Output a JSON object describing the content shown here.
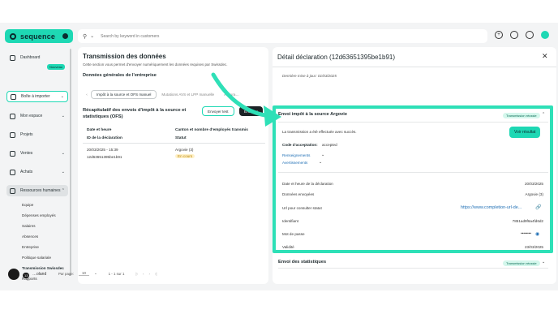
{
  "brand": {
    "name": "sequence"
  },
  "search": {
    "placeholder": "Search by keyword in customers"
  },
  "sidebar": {
    "items": [
      {
        "label": "Dashboard"
      },
      {
        "label": "Boîte à importer",
        "badge": "Nouveau"
      },
      {
        "label": "Mon espace"
      },
      {
        "label": "Projets"
      },
      {
        "label": "Ventes"
      },
      {
        "label": "Achats"
      },
      {
        "label": "Ressources humaines"
      }
    ],
    "subitems": [
      "Equipe",
      "Dépenses employés",
      "Salaires",
      "Absences",
      "Entreprise",
      "Politique salariale",
      "Transmission Swissdec",
      "Rapports"
    ],
    "user": {
      "initials": "13",
      "count": "13",
      "name": "…oland"
    }
  },
  "middle": {
    "title": "Transmission des données",
    "description": "Cette section vous permet d'envoyer numériquement les données requises par Swissdec.",
    "section_title": "Données générales de l'entreprise",
    "tabs": [
      "Impôt à la source et OFS manuel",
      "Mutations AVS et LPP manuelle",
      "Assura…"
    ],
    "recap_title": "Récapitulatif des envois d'impôt à la source et statistiques (OFS)",
    "btn_test": "Envoyer test",
    "btn_send": "Envoyer",
    "table": {
      "h1": "Date et heure",
      "h1b": "ID de la déclaration",
      "h2": "Canton et nombre d'employés transmis",
      "h2b": "Statut",
      "row": {
        "date": "20/03/2025 - 15:39",
        "id": "12d63651395be1b91",
        "canton": "Argovie (3)",
        "status": "En cours"
      }
    },
    "pager": {
      "label": "Par page:",
      "per_page": "10",
      "range": "1 - 1 sur 1"
    }
  },
  "right": {
    "title": "Détail déclaration (12d63651395be1b91)",
    "last_update": "Dernière mise à jour: 01/03/2025",
    "section1": {
      "title": "Envoi impôt à la source Argovie",
      "status": "Transmission réussie",
      "message": "La transmission a été effectuée avec succès.",
      "btn_result": "Voir résultat",
      "acceptance_label": "Code d'acceptation:",
      "acceptance_value": "accepted",
      "link1": "Renseignements",
      "link2": "Avertissements",
      "fields": [
        {
          "label": "Date et heure de la déclaration",
          "value": "20/03/2025"
        },
        {
          "label": "Données envoyées",
          "value": "Argovie (3)"
        },
        {
          "label": "Url pour consulter statut",
          "value": "https://www.completion-url-de..."
        },
        {
          "label": "Identifiant",
          "value": "7851ad9f6a4fd6d2"
        },
        {
          "label": "Mot de passe",
          "value": "••••••••"
        },
        {
          "label": "Validité",
          "value": "23/03/2025"
        }
      ]
    },
    "section2": {
      "title": "Envoi des statistiques",
      "status": "Transmission réussie"
    }
  },
  "colors": {
    "accent": "#1ed8b4",
    "highlight": "#2ee0b7",
    "dark": "#1c2326",
    "link": "#1f6fb5"
  }
}
